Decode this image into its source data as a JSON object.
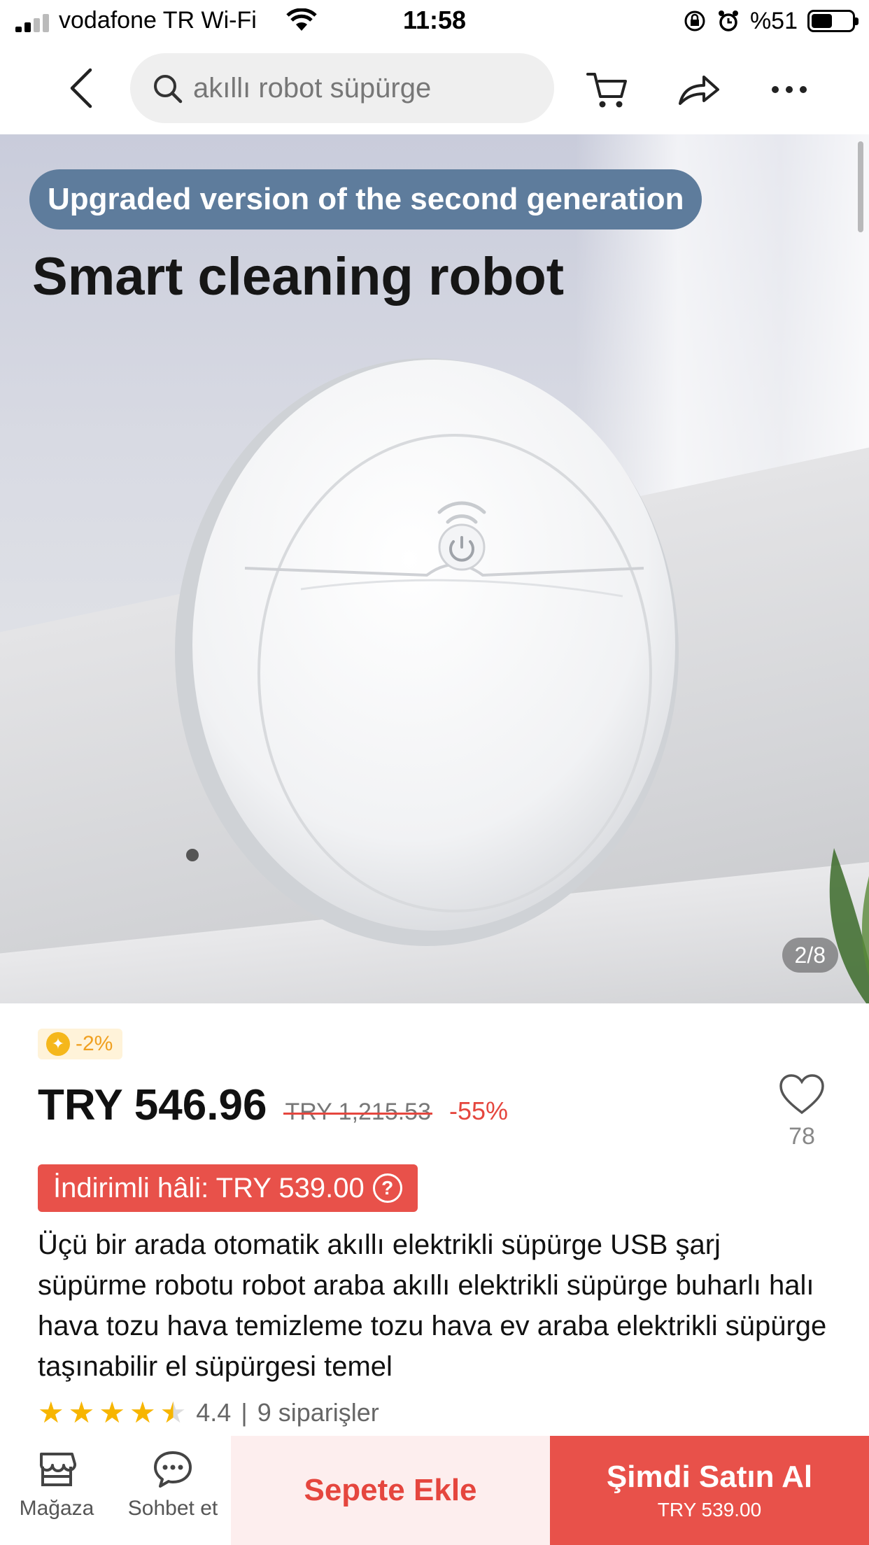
{
  "status_bar": {
    "carrier": "vodafone TR Wi-Fi",
    "time": "11:58",
    "battery": "%51",
    "battery_level": 0.51
  },
  "header": {
    "search_text": "akıllı robot süpürge",
    "icons": [
      "back-icon",
      "search-icon",
      "cart-icon",
      "share-icon",
      "more-icon"
    ]
  },
  "hero": {
    "badge": "Upgraded version of the second generation",
    "title": "Smart cleaning robot",
    "page_indicator": "2/8"
  },
  "product": {
    "coin_discount": "-2%",
    "price": "TRY 546.96",
    "old_price": "TRY 1,215.53",
    "discount": "-55%",
    "wishlist_count": "78",
    "promo": "İndirimli hâli: TRY 539.00",
    "promo_help": "?",
    "title": "Üçü bir arada otomatik akıllı elektrikli süpürge USB şarj süpürme robotu robot araba akıllı elektrikli süpürge buharlı halı hava tozu hava temizleme tozu hava ev araba elektrikli süpürge taşınabilir el süpürgesi temel",
    "rating": "4.4",
    "rating_value": 4.4,
    "rating_sep": "|",
    "orders": "9 siparişler"
  },
  "bottom_bar": {
    "store_label": "Mağaza",
    "chat_label": "Sohbet et",
    "add_to_cart": "Sepete Ekle",
    "buy_now": "Şimdi Satın Al",
    "buy_now_price": "TRY 539.00"
  },
  "colors": {
    "accent": "#e8514a",
    "accent_light": "#fdeeee",
    "star": "#f7b500",
    "coin": "#f5b71b",
    "badge_blue": "#5e7c9c"
  }
}
